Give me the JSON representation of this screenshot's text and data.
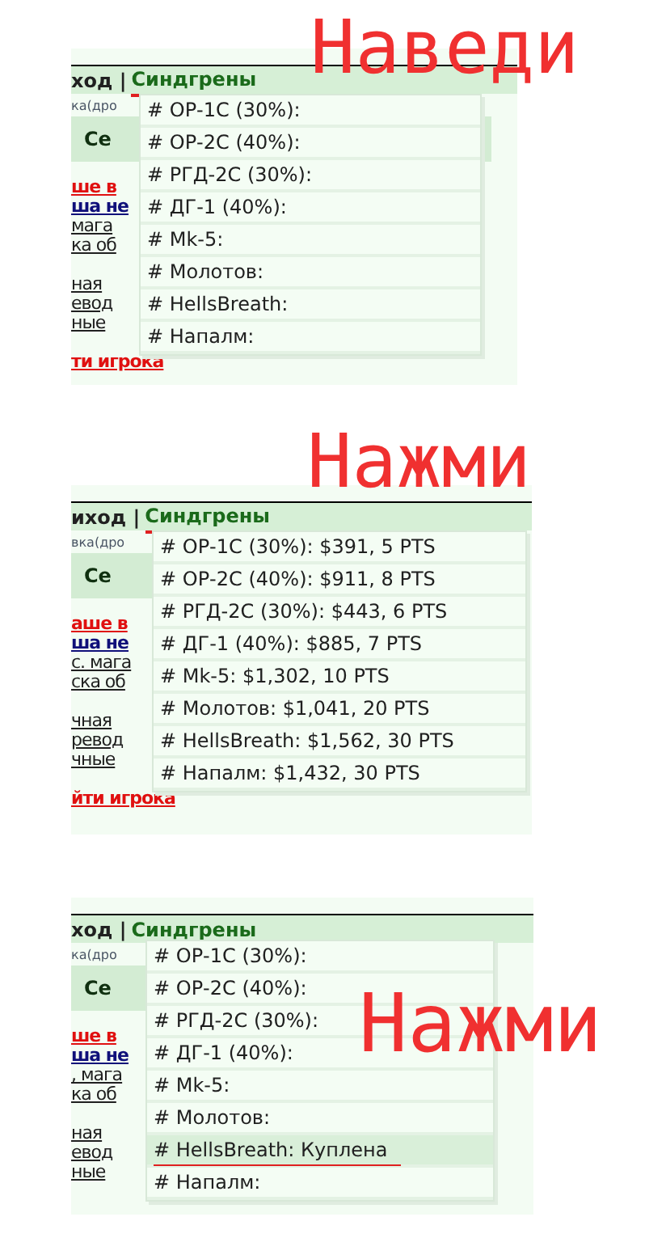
{
  "panels": [
    {
      "caption": "Наведи",
      "nav_left": "ход |",
      "nav_active": {
        "label": "Синдгрены",
        "underlined": true
      },
      "side_groups": [
        [
          {
            "kind": "small",
            "text": "ка(дро"
          },
          {
            "kind": "heading",
            "text": "Се"
          }
        ],
        [
          {
            "kind": "link_red",
            "text": "ше в"
          },
          {
            "kind": "link_blue",
            "text": "ша не"
          },
          {
            "kind": "link",
            "text": "мага"
          },
          {
            "kind": "link",
            "text": "ка об"
          }
        ],
        [
          {
            "kind": "link",
            "text": "ная"
          },
          {
            "kind": "link",
            "text": "евод"
          },
          {
            "kind": "link",
            "text": "ные"
          }
        ],
        [
          {
            "kind": "link_red",
            "text": "ти игрока"
          }
        ]
      ],
      "menu": [
        {
          "text": "# ОР-1С (30%):",
          "selected": false
        },
        {
          "text": "# ОР-2С (40%):",
          "selected": false
        },
        {
          "text": "# РГД-2С (30%):",
          "selected": false
        },
        {
          "text": "# ДГ-1 (40%):",
          "selected": false
        },
        {
          "text": "# Mk-5:",
          "selected": false
        },
        {
          "text": "# Молотов:",
          "selected": false
        },
        {
          "text": "# HellsBreath:",
          "selected": false
        },
        {
          "text": "# Напалм:",
          "selected": false
        }
      ]
    },
    {
      "caption": "Нажми",
      "nav_left": "иход |",
      "nav_active": {
        "label": "Синдгрены",
        "underlined": true
      },
      "side_groups": [
        [
          {
            "kind": "small",
            "text": "вка(дро"
          },
          {
            "kind": "heading",
            "text": "Се"
          }
        ],
        [
          {
            "kind": "link_red",
            "text": "аше в"
          },
          {
            "kind": "link_blue",
            "text": "ша не"
          },
          {
            "kind": "link",
            "text": "с. мага"
          },
          {
            "kind": "link",
            "text": "ска об"
          }
        ],
        [
          {
            "kind": "link",
            "text": "чная"
          },
          {
            "kind": "link",
            "text": "ревод"
          },
          {
            "kind": "link",
            "text": "чные"
          }
        ],
        [
          {
            "kind": "link_red",
            "text": "йти игрока"
          }
        ]
      ],
      "menu": [
        {
          "text": "# ОР-1С (30%): $391, 5 PTS",
          "selected": false
        },
        {
          "text": "# ОР-2С (40%): $911, 8 PTS",
          "selected": false
        },
        {
          "text": "# РГД-2С (30%): $443, 6 PTS",
          "selected": false
        },
        {
          "text": "# ДГ-1 (40%): $885, 7 PTS",
          "selected": false
        },
        {
          "text": "# Mk-5: $1,302, 10 PTS",
          "selected": false
        },
        {
          "text": "# Молотов: $1,041, 20 PTS",
          "selected": false
        },
        {
          "text": "# HellsBreath: $1,562, 30 PTS",
          "selected": false
        },
        {
          "text": "# Напалм: $1,432, 30 PTS",
          "selected": false
        }
      ]
    },
    {
      "caption": "Нажми",
      "nav_left": "ход |",
      "nav_active": {
        "label": "Синдгрены",
        "underlined": false
      },
      "side_groups": [
        [
          {
            "kind": "small",
            "text": "ка(дро"
          },
          {
            "kind": "heading",
            "text": "Се"
          }
        ],
        [
          {
            "kind": "link_red",
            "text": "ше в"
          },
          {
            "kind": "link_blue",
            "text": "ша не"
          },
          {
            "kind": "link",
            "text": ", мага"
          },
          {
            "kind": "link",
            "text": "ка об"
          }
        ],
        [
          {
            "kind": "link",
            "text": "ная"
          },
          {
            "kind": "link",
            "text": "евод"
          },
          {
            "kind": "link",
            "text": "ные"
          }
        ]
      ],
      "menu": [
        {
          "text": "# ОР-1С (30%):",
          "selected": false
        },
        {
          "text": "# ОР-2С (40%):",
          "selected": false
        },
        {
          "text": "# РГД-2С (30%):",
          "selected": false
        },
        {
          "text": "# ДГ-1 (40%):",
          "selected": false
        },
        {
          "text": "# Mk-5:",
          "selected": false
        },
        {
          "text": "# Молотов:",
          "selected": false
        },
        {
          "text": "# HellsBreath: Куплена",
          "selected": true
        },
        {
          "text": "# Напалм:",
          "selected": false
        }
      ]
    }
  ]
}
